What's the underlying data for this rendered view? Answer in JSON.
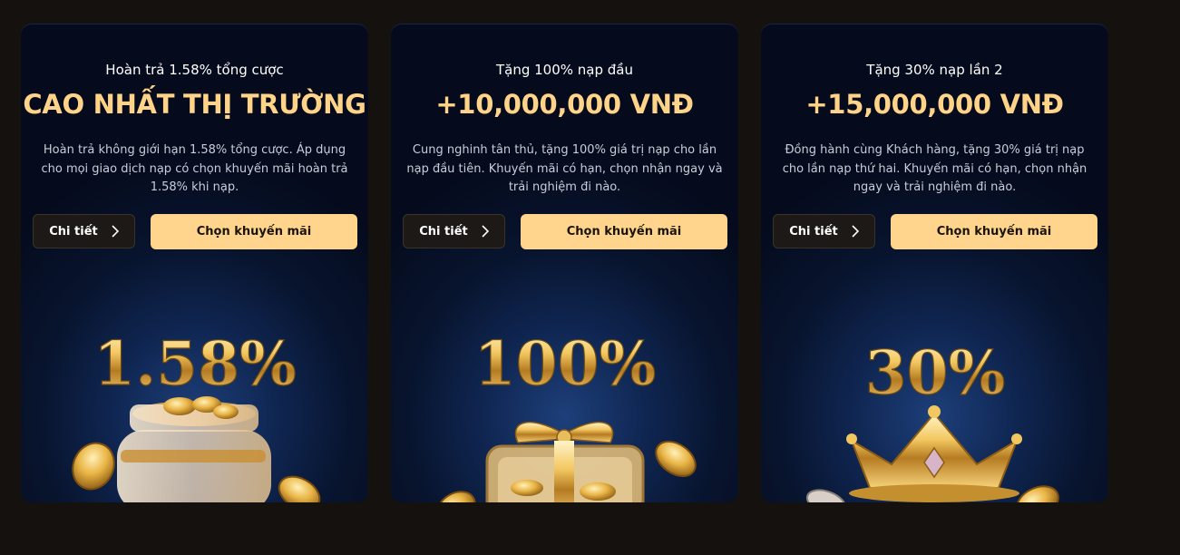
{
  "cards": [
    {
      "subtitle": "Hoàn trả 1.58% tổng cược",
      "headline": "CAO NHẤT THỊ TRƯỜNG",
      "description": "Hoàn trả không giới hạn 1.58% tổng cược. Áp dụng cho mọi giao dịch nạp có chọn khuyến mãi hoàn trả 1.58% khi nạp.",
      "detail_label": "Chi tiết",
      "promo_label": "Chọn khuyến mãi",
      "art_text": "1.58%",
      "art_icon": "coin-jar"
    },
    {
      "subtitle": "Tặng 100% nạp đầu",
      "headline": "+10,000,000 VNĐ",
      "description": "Cung nghinh tân thủ, tặng 100% giá trị nạp cho lần nạp đầu tiên. Khuyến mãi có hạn, chọn nhận ngay và trải nghiệm đi nào.",
      "detail_label": "Chi tiết",
      "promo_label": "Chọn khuyến mãi",
      "art_text": "100%",
      "art_icon": "gift-box"
    },
    {
      "subtitle": "Tặng 30% nạp lần 2",
      "headline": "+15,000,000 VNĐ",
      "description": "Đồng hành cùng Khách hàng, tặng 30% giá trị nạp cho lần nạp thứ hai. Khuyến mãi có hạn, chọn nhận ngay và trải nghiệm đi nào.",
      "detail_label": "Chi tiết",
      "promo_label": "Chọn khuyến mãi",
      "art_text": "30%",
      "art_icon": "crown"
    }
  ],
  "colors": {
    "page_bg": "#14110e",
    "headline_gold": "#ffd489",
    "promo_button": "#ffd48c",
    "card_dark": "#050b1d",
    "card_glow": "#1d3f7a"
  }
}
